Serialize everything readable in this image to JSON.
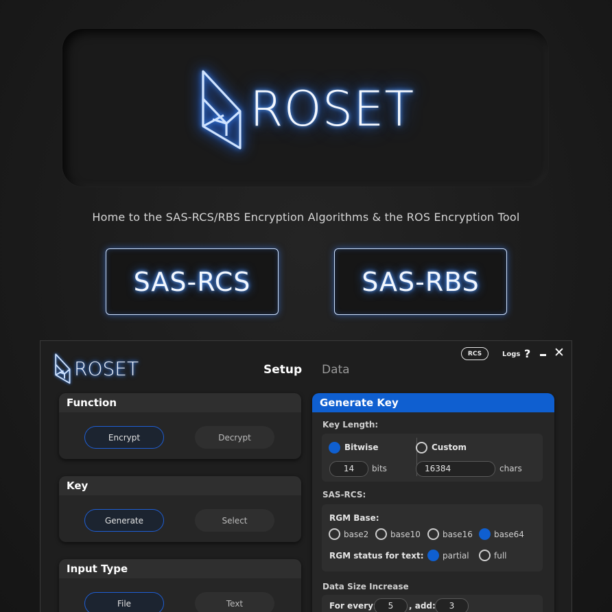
{
  "hero": {
    "wordmark": "ROSET",
    "tagline": "Home to the SAS-RCS/RBS Encryption Algorithms &  the ROS Encryption Tool",
    "buttons": [
      "SAS-RCS",
      "SAS-RBS"
    ]
  },
  "colors": {
    "accent": "#0f5fd0",
    "glow": "#2f7bff"
  },
  "app": {
    "wordmark": "ROSET",
    "tabs": [
      {
        "label": "Setup",
        "active": true
      },
      {
        "label": "Data",
        "active": false
      }
    ],
    "titlebar": {
      "badge": "RCS",
      "logs": "Logs",
      "help": "?",
      "minimize": "-",
      "close": "✕"
    },
    "panels": {
      "function": {
        "title": "Function",
        "options": [
          "Encrypt",
          "Decrypt"
        ],
        "selected": "Encrypt"
      },
      "key": {
        "title": "Key",
        "options": [
          "Generate",
          "Select"
        ],
        "selected": "Generate"
      },
      "input_type": {
        "title": "Input Type",
        "options": [
          "File",
          "Text"
        ],
        "selected": "File"
      }
    },
    "generate_key": {
      "title": "Generate Key",
      "key_length_label": "Key Length:",
      "bitwise_label": "Bitwise",
      "custom_label": "Custom",
      "bits_value": "14",
      "bits_unit": "bits",
      "chars_value": "16384",
      "chars_unit": "chars",
      "sas_rcs_label": "SAS-RCS:",
      "rgm_base_label": "RGM Base:",
      "rgm_bases": [
        "base2",
        "base10",
        "base16",
        "base64"
      ],
      "rgm_base_selected": "base64",
      "rgm_status_label": "RGM status for text:",
      "rgm_status_options": [
        "partial",
        "full"
      ],
      "rgm_status_selected": "partial",
      "data_size_label": "Data Size Increase",
      "for_every_label": "For every:",
      "for_every_value": "5",
      "add_label": ", add:",
      "add_value": "3"
    }
  }
}
